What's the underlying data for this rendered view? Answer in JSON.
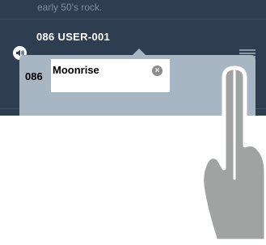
{
  "list": {
    "previous_description": "early 50's rock.",
    "preset_name": "086 USER-001"
  },
  "icons": {
    "speaker": "speaker-icon",
    "drag_handle": "drag-handle-icon",
    "clear": "clear-icon"
  },
  "edit_panel": {
    "preset_number": "086",
    "name_value": "Moonrise",
    "clear_glyph": "×"
  },
  "colors": {
    "list_background": "#2e3e50",
    "panel_background": "#a8b6c4",
    "finger": "#a0a3a2"
  }
}
